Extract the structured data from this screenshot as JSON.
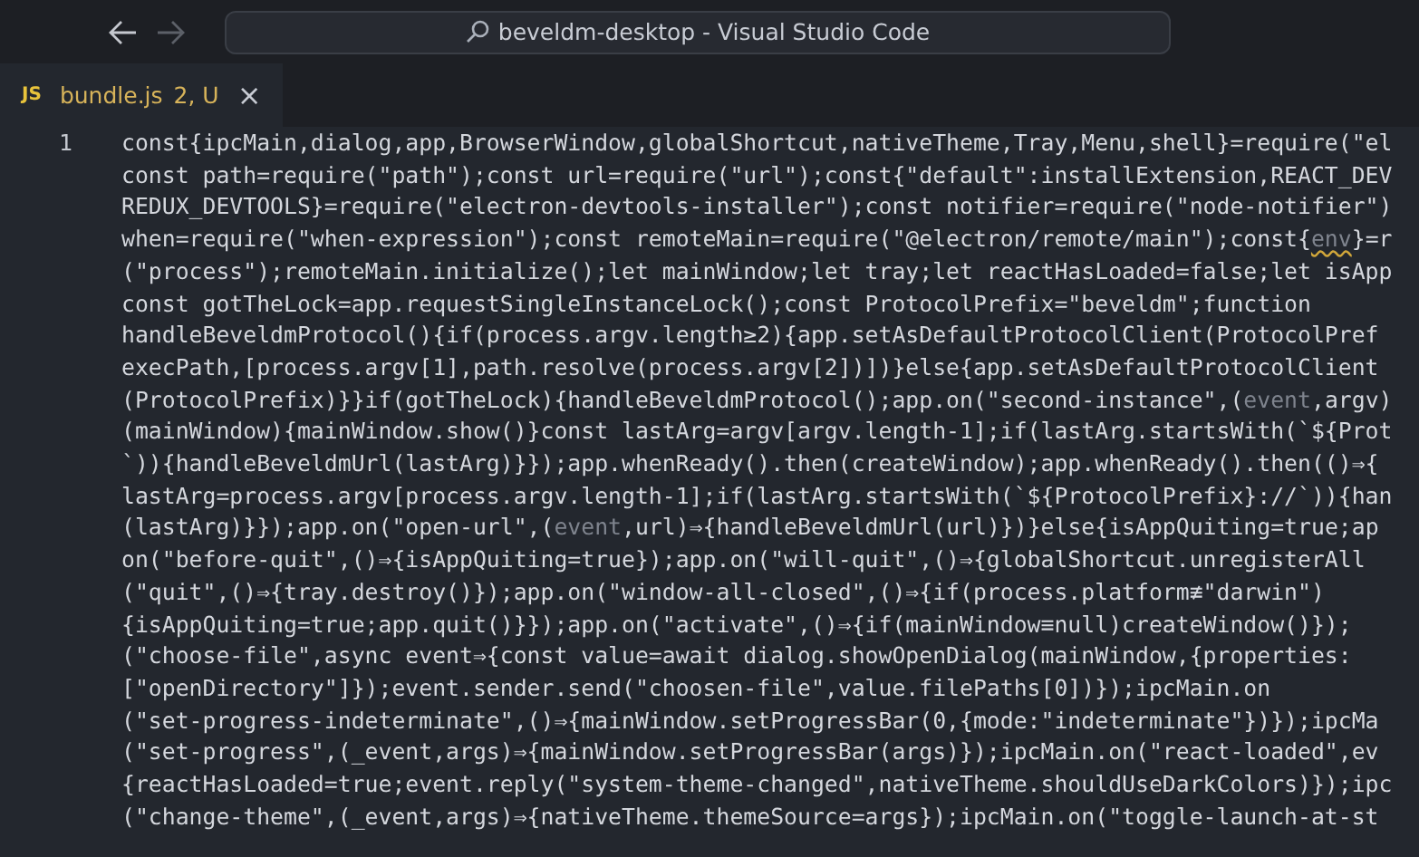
{
  "window": {
    "title": "beveldm-desktop - Visual Studio Code"
  },
  "tabs": [
    {
      "icon_text": "JS",
      "label": "bundle.js",
      "status": "2, U",
      "close": "×",
      "selected": true
    }
  ],
  "editor": {
    "line_numbers": [
      "1"
    ],
    "lines": [
      [
        {
          "text": "const{ipcMain,dialog,app,BrowserWindow,globalShortcut,nativeTheme,Tray,Menu,shell}=require(\"el",
          "kind": "plain"
        }
      ],
      [
        {
          "text": "const path=require(\"path\");const url=require(\"url\");const{\"default\":installExtension,REACT_DEV",
          "kind": "plain"
        }
      ],
      [
        {
          "text": "REDUX_DEVTOOLS}=require(\"electron-devtools-installer\");const notifier=require(\"node-notifier\")",
          "kind": "plain"
        }
      ],
      [
        {
          "text": "when=require(\"when-expression\");const remoteMain=require(\"@electron/remote/main\");const{",
          "kind": "plain"
        },
        {
          "text": "env",
          "kind": "warning"
        },
        {
          "text": "}=r",
          "kind": "plain"
        }
      ],
      [
        {
          "text": "(\"process\");remoteMain.initialize();let mainWindow;let tray;let reactHasLoaded=false;let isApp",
          "kind": "plain"
        }
      ],
      [
        {
          "text": "const gotTheLock=app.requestSingleInstanceLock();const ProtocolPrefix=\"beveldm\";function",
          "kind": "plain"
        }
      ],
      [
        {
          "text": "handleBeveldmProtocol(){if(process.argv.length≥2){app.setAsDefaultProtocolClient(ProtocolPref",
          "kind": "plain"
        }
      ],
      [
        {
          "text": "execPath,[process.argv[1],path.resolve(process.argv[2])])}else{app.setAsDefaultProtocolClient",
          "kind": "plain"
        }
      ],
      [
        {
          "text": "(ProtocolPrefix)}}if(gotTheLock){handleBeveldmProtocol();app.on(\"second-instance\",(",
          "kind": "plain"
        },
        {
          "text": "event",
          "kind": "unused"
        },
        {
          "text": ",argv)",
          "kind": "plain"
        }
      ],
      [
        {
          "text": "(mainWindow){mainWindow.show()}const lastArg=argv[argv.length-1];if(lastArg.startsWith(`${Prot",
          "kind": "plain"
        }
      ],
      [
        {
          "text": "`)){handleBeveldmUrl(lastArg)}});app.whenReady().then(createWindow);app.whenReady().then(()⇒{",
          "kind": "plain"
        }
      ],
      [
        {
          "text": "lastArg=process.argv[process.argv.length-1];if(lastArg.startsWith(`${ProtocolPrefix}://`)){han",
          "kind": "plain"
        }
      ],
      [
        {
          "text": "(lastArg)}});app.on(\"open-url\",(",
          "kind": "plain"
        },
        {
          "text": "event",
          "kind": "unused"
        },
        {
          "text": ",url)⇒{handleBeveldmUrl(url)})}else{isAppQuiting=true;ap",
          "kind": "plain"
        }
      ],
      [
        {
          "text": "on(\"before-quit\",()⇒{isAppQuiting=true});app.on(\"will-quit\",()⇒{globalShortcut.unregisterAll",
          "kind": "plain"
        }
      ],
      [
        {
          "text": "(\"quit\",()⇒{tray.destroy()});app.on(\"window-all-closed\",()⇒{if(process.platform≢\"darwin\")",
          "kind": "plain"
        }
      ],
      [
        {
          "text": "{isAppQuiting=true;app.quit()}});app.on(\"activate\",()⇒{if(mainWindow≡null)createWindow()});",
          "kind": "plain"
        }
      ],
      [
        {
          "text": "(\"choose-file\",async event⇒{const value=await dialog.showOpenDialog(mainWindow,{properties:",
          "kind": "plain"
        }
      ],
      [
        {
          "text": "[\"openDirectory\"]});event.sender.send(\"choosen-file\",value.filePaths[0])});ipcMain.on",
          "kind": "plain"
        }
      ],
      [
        {
          "text": "(\"set-progress-indeterminate\",()⇒{mainWindow.setProgressBar(0,{mode:\"indeterminate\"})});ipcMa",
          "kind": "plain"
        }
      ],
      [
        {
          "text": "(\"set-progress\",(_event,args)⇒{mainWindow.setProgressBar(args)});ipcMain.on(\"react-loaded\",ev",
          "kind": "plain"
        }
      ],
      [
        {
          "text": "{reactHasLoaded=true;event.reply(\"system-theme-changed\",nativeTheme.shouldUseDarkColors)});ipc",
          "kind": "plain"
        }
      ],
      [
        {
          "text": "(\"change-theme\",(_event,args)⇒{nativeTheme.themeSource=args});ipcMain.on(\"toggle-launch-at-st",
          "kind": "plain"
        }
      ]
    ]
  }
}
